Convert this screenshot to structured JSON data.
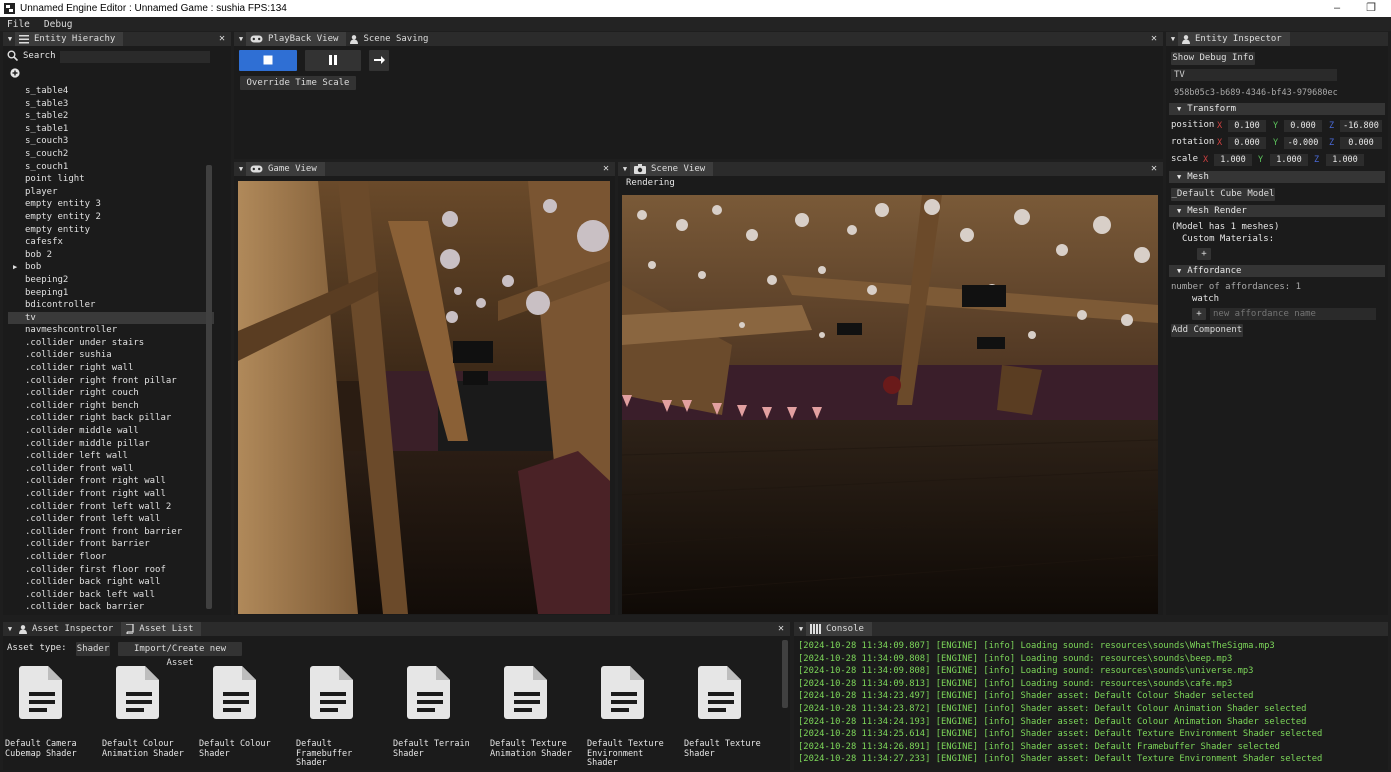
{
  "window": {
    "title": "Unnamed Engine Editor : Unnamed Game : sushia  FPS:134",
    "minimize": "–",
    "restore": "❐"
  },
  "menu": [
    "File",
    "Debug"
  ],
  "hierarchy": {
    "tab": "Entity Hierachy",
    "search_label": "Search",
    "items": [
      "s_table4",
      "s_table3",
      "s_table2",
      "s_table1",
      "s_couch3",
      "s_couch2",
      "s_couch1",
      "point light",
      "player",
      "empty entity 3",
      "empty entity 2",
      "empty entity",
      "cafesfx",
      "bob 2",
      "bob",
      "beeping2",
      "beeping1",
      "bdicontroller",
      "tv",
      "navmeshcontroller",
      ".collider under stairs",
      ".collider sushia",
      ".collider right wall",
      ".collider right front pillar",
      ".collider right couch",
      ".collider right bench",
      ".collider right back pillar",
      ".collider middle wall",
      ".collider middle pillar",
      ".collider left wall",
      ".collider front wall",
      ".collider front right wall",
      ".collider front right wall",
      ".collider front left wall 2",
      ".collider front left wall",
      ".collider front front barrier",
      ".collider front barrier",
      ".collider floor",
      ".collider first floor roof",
      ".collider back right wall",
      ".collider back left wall",
      ".collider back barrier"
    ],
    "selected": "tv",
    "expandable": "bob"
  },
  "playback": {
    "tab": "PlayBack View",
    "tab2": "Scene Saving",
    "override_label": "Override Time Scale"
  },
  "game_view": {
    "tab": "Game View"
  },
  "scene_view": {
    "tab": "Scene View",
    "status": "Rendering"
  },
  "inspector": {
    "tab": "Entity Inspector",
    "show_debug": "Show Debug Info",
    "name": "TV",
    "uuid": "958b05c3-b689-4346-bf43-979680ec",
    "transform": {
      "header": "Transform",
      "position_label": "position",
      "rotation_label": "rotation",
      "scale_label": "scale",
      "position": {
        "x": "0.100",
        "y": "0.000",
        "z": "-16.800"
      },
      "rotation": {
        "x": "0.000",
        "y": "-0.000",
        "z": "0.000"
      },
      "scale": {
        "x": "1.000",
        "y": "1.000",
        "z": "1.000"
      },
      "axis_x": "X",
      "axis_y": "Y",
      "axis_z": "Z"
    },
    "mesh": {
      "header": "Mesh",
      "model": "_Default Cube Model"
    },
    "mesh_render": {
      "header": "Mesh Render",
      "info": "(Model has 1 meshes)",
      "custom_materials": "Custom Materials:",
      "add": "+"
    },
    "affordance": {
      "header": "Affordance",
      "count": "number of affordances: 1",
      "item": "watch",
      "add": "+",
      "placeholder": "new affordance name"
    },
    "add_component": "Add Component"
  },
  "assets": {
    "tab": "Asset Inspector",
    "tab2": "Asset List",
    "type_label": "Asset type:",
    "type_value": "Shader",
    "import_button": "Import/Create new Asset",
    "items": [
      "Default Camera Cubemap Shader",
      "Default Colour Animation Shader",
      "Default Colour Shader",
      "Default Framebuffer Shader",
      "Default Terrain Shader",
      "Default Texture Animation Shader",
      "Default Texture Environment Shader",
      "Default Texture Shader"
    ]
  },
  "console": {
    "tab": "Console",
    "lines": [
      "[2024-10-28 11:34:09.807] [ENGINE] [info] Loading sound: resources\\sounds\\WhatTheSigma.mp3",
      "[2024-10-28 11:34:09.808] [ENGINE] [info] Loading sound: resources\\sounds\\beep.mp3",
      "[2024-10-28 11:34:09.808] [ENGINE] [info] Loading sound: resources\\sounds\\universe.mp3",
      "[2024-10-28 11:34:09.813] [ENGINE] [info] Loading sound: resources\\sounds\\cafe.mp3",
      "[2024-10-28 11:34:23.497] [ENGINE] [info] Shader asset: Default Colour Shader selected",
      "[2024-10-28 11:34:23.872] [ENGINE] [info] Shader asset: Default Colour Animation Shader selected",
      "[2024-10-28 11:34:24.193] [ENGINE] [info] Shader asset: Default Colour Animation Shader selected",
      "[2024-10-28 11:34:25.614] [ENGINE] [info] Shader asset: Default Texture Environment Shader selected",
      "[2024-10-28 11:34:26.891] [ENGINE] [info] Shader asset: Default Framebuffer Shader selected",
      "[2024-10-28 11:34:27.233] [ENGINE] [info] Shader asset: Default Texture Environment Shader selected"
    ]
  },
  "colors": {
    "accent": "#2f6fd4",
    "console_text": "#7dd75a",
    "axis_x": "#d04040",
    "axis_y": "#5cc25c",
    "axis_z": "#4a6ad8"
  }
}
